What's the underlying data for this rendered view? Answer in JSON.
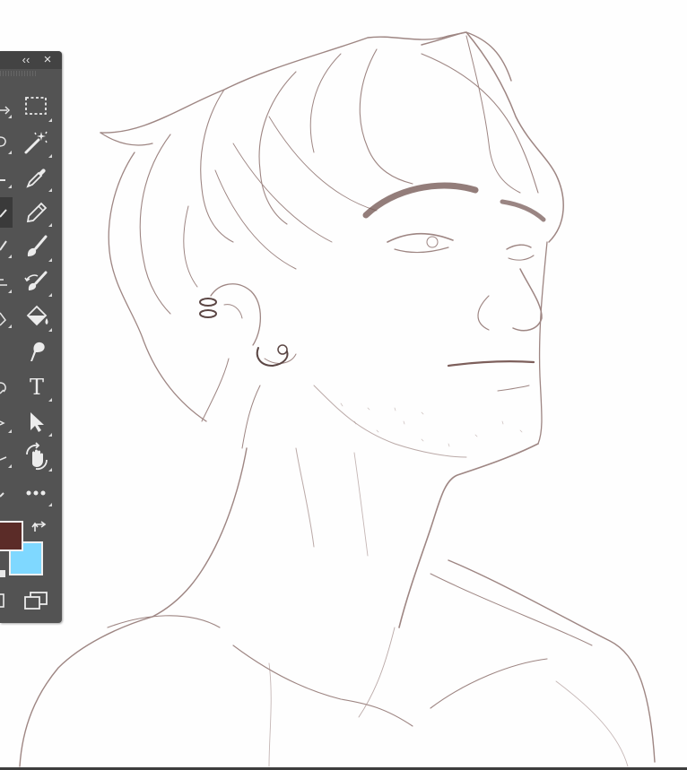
{
  "panel": {
    "collapse_glyph": "‹‹",
    "close_glyph": "×",
    "collapse_icon": "double-chevron-left-icon",
    "close_icon": "close-icon"
  },
  "tools": [
    {
      "name": "rectangular-marquee-tool",
      "icon": "rectangular-marquee-icon"
    },
    {
      "name": "magic-wand-tool",
      "icon": "magic-wand-icon"
    },
    {
      "name": "eyedropper-tool",
      "icon": "eyedropper-icon"
    },
    {
      "name": "pencil-tool",
      "icon": "pencil-icon"
    },
    {
      "name": "brush-tool",
      "icon": "brush-icon"
    },
    {
      "name": "history-brush-tool",
      "icon": "history-brush-icon"
    },
    {
      "name": "paint-bucket-tool",
      "icon": "paint-bucket-icon"
    },
    {
      "name": "smudge-tool",
      "icon": "smudge-icon"
    },
    {
      "name": "type-tool",
      "icon": "type-icon",
      "glyph": "T"
    },
    {
      "name": "path-selection-tool",
      "icon": "arrow-pointer-icon"
    },
    {
      "name": "rotate-view-tool",
      "icon": "rotate-view-hand-icon"
    },
    {
      "name": "edit-toolbar",
      "icon": "more-dots-icon",
      "glyph": "•••"
    }
  ],
  "colors": {
    "foreground": "#5b2c28",
    "background": "#7fd8ff",
    "panel_bg": "#535353",
    "sketch_line": "#9e8683"
  }
}
